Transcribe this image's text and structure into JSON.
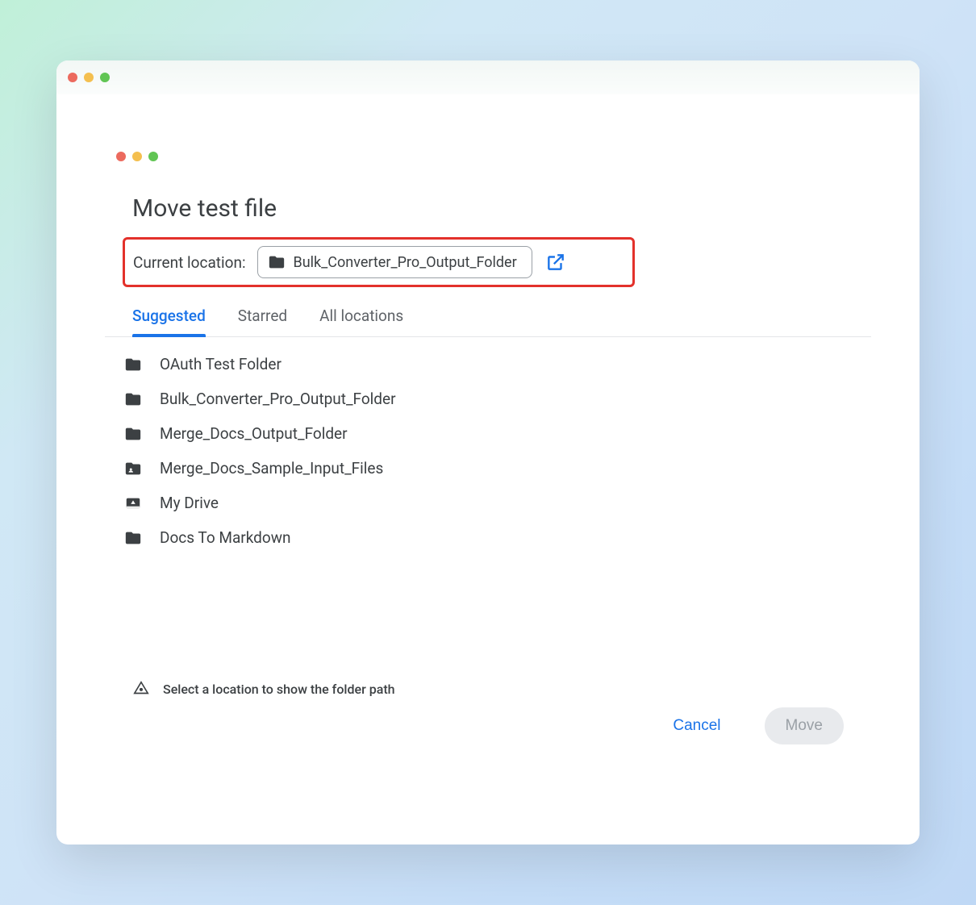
{
  "dialog": {
    "title": "Move test file",
    "location_label": "Current location:",
    "current_folder": "Bulk_Converter_Pro_Output_Folder"
  },
  "tabs": [
    {
      "label": "Suggested",
      "active": true
    },
    {
      "label": "Starred",
      "active": false
    },
    {
      "label": "All locations",
      "active": false
    }
  ],
  "items": [
    {
      "icon": "folder",
      "label": "OAuth Test Folder"
    },
    {
      "icon": "folder",
      "label": "Bulk_Converter_Pro_Output_Folder"
    },
    {
      "icon": "folder",
      "label": "Merge_Docs_Output_Folder"
    },
    {
      "icon": "shared-folder",
      "label": "Merge_Docs_Sample_Input_Files"
    },
    {
      "icon": "drive",
      "label": "My Drive"
    },
    {
      "icon": "folder",
      "label": "Docs To Markdown"
    }
  ],
  "hint": "Select a location to show the folder path",
  "buttons": {
    "cancel": "Cancel",
    "move": "Move"
  },
  "colors": {
    "accent": "#1a73e8",
    "highlight_border": "#e3312b"
  }
}
